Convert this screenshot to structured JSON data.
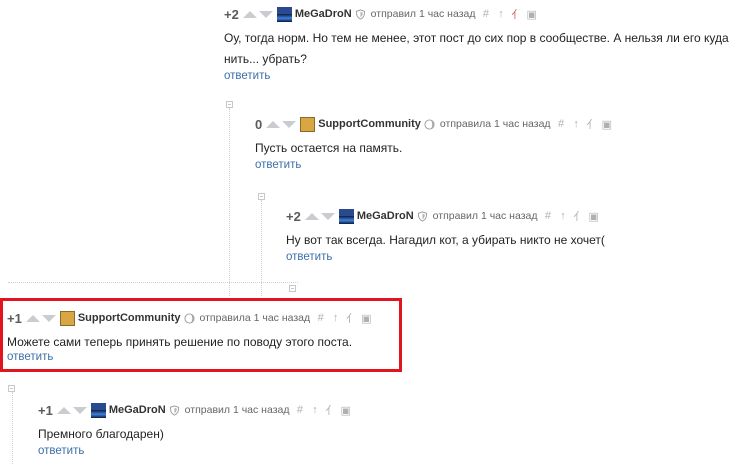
{
  "comments": [
    {
      "rating": "+2",
      "username": "MeGaDroN",
      "action_time": "отправил 1 час назад",
      "text": "Оу, тогда норм. Но тем не менее, этот пост до сих пор в сообществе. А нельзя ли его куда нить... убрать?",
      "reply": "ответить",
      "avatar": "megadron-avatar",
      "badge": "shield-icon"
    },
    {
      "rating": "0",
      "username": "SupportCommunity",
      "action_time": "отправила 1 час назад",
      "text": "Пусть остается на память.",
      "reply": "ответить",
      "avatar": "support-avatar",
      "badge": "moon-icon"
    },
    {
      "rating": "+2",
      "username": "MeGaDroN",
      "action_time": "отправил 1 час назад",
      "text": "Ну вот так всегда. Нагадил кот, а убирать никто не хочет(",
      "reply": "ответить",
      "avatar": "megadron-avatar",
      "badge": "shield-icon"
    },
    {
      "rating": "+1",
      "username": "SupportCommunity",
      "action_time": "отправила 1 час назад",
      "text": "Можете сами теперь принять решение по поводу этого поста.",
      "reply": "ответить",
      "avatar": "support-avatar",
      "badge": "moon-icon",
      "highlighted": true
    },
    {
      "rating": "+1",
      "username": "MeGaDroN",
      "action_time": "отправил 1 час назад",
      "text": "Премного благодарен)",
      "reply": "ответить",
      "avatar": "megadron-avatar",
      "badge": "shield-icon"
    }
  ],
  "toolbar_glyphs": {
    "link": "#",
    "parent": "↑",
    "branch": "⺅",
    "save": "▣"
  },
  "colors": {
    "highlight_border": "#e0151d",
    "reply_link": "#3a6fa8",
    "vote_arrow": "#c9ccd0"
  }
}
